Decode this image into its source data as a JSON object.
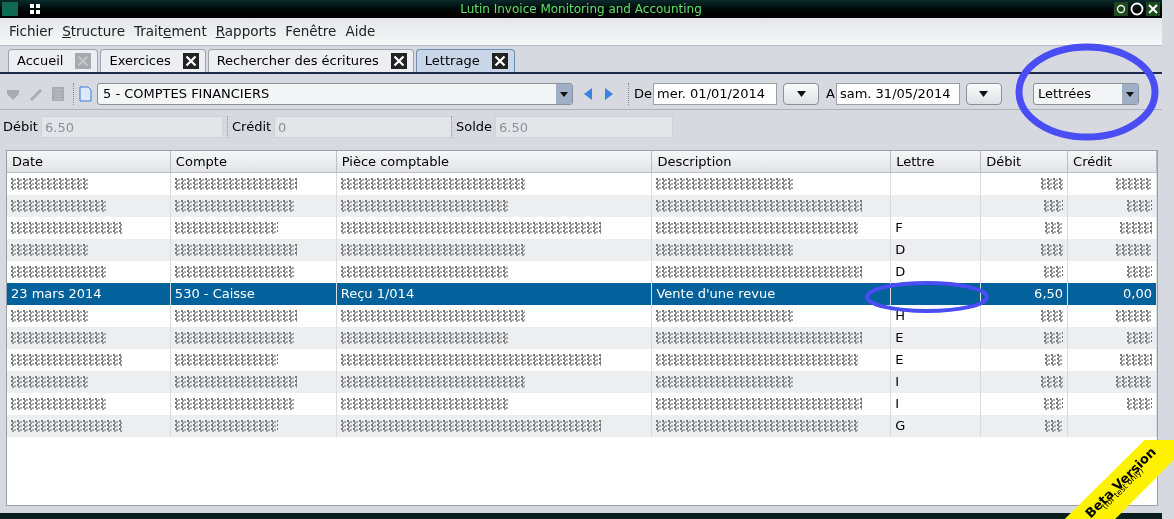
{
  "window": {
    "title": "Lutin Invoice Monitoring and Accounting"
  },
  "menu": [
    {
      "label": "Fichier"
    },
    {
      "key": "S",
      "after": "tructure"
    },
    {
      "before": "Trait",
      "key": "e",
      "after": "ment"
    },
    {
      "key": "R",
      "after": "apports"
    },
    {
      "label": "Fenêtre"
    },
    {
      "label": "Aide"
    }
  ],
  "tabs": [
    {
      "label": "Accueil",
      "selected": false,
      "close_enabled": false
    },
    {
      "label": "Exercices",
      "selected": false,
      "close_enabled": true
    },
    {
      "label": "Rechercher des écritures",
      "selected": false,
      "close_enabled": true
    },
    {
      "label": "Lettrage",
      "selected": true,
      "close_enabled": true
    }
  ],
  "toolbar": {
    "account": "5 - COMPTES FINANCIERS",
    "from_label": "De",
    "from": "mer. 01/01/2014",
    "to_label": "A",
    "to": "sam. 31/05/2014",
    "filter": "Lettrées"
  },
  "totals": [
    {
      "label": "Débit",
      "value": "6.50"
    },
    {
      "label": "Crédit",
      "value": "0"
    },
    {
      "label": "Solde",
      "value": "6.50"
    }
  ],
  "table": {
    "columns": [
      "Date",
      "Compte",
      "Pièce comptable",
      "Description",
      "Lettre",
      "Débit",
      "Crédit"
    ],
    "rows": [
      {
        "kind": "blurred",
        "selected": false,
        "lettre": ""
      },
      {
        "kind": "blurred",
        "selected": false,
        "lettre": ""
      },
      {
        "kind": "blurred",
        "selected": false,
        "lettre": "F"
      },
      {
        "kind": "blurred",
        "selected": false,
        "lettre": "D"
      },
      {
        "kind": "blurred",
        "selected": false,
        "lettre": "D"
      },
      {
        "kind": "plain",
        "selected": true,
        "cells": [
          "23 mars 2014",
          "530 - Caisse",
          "Reçu 1/014",
          "Vente d'une revue",
          "",
          "6,50",
          "0,00"
        ]
      },
      {
        "kind": "blurred",
        "selected": false,
        "lettre": "H"
      },
      {
        "kind": "blurred",
        "selected": false,
        "lettre": "E"
      },
      {
        "kind": "blurred",
        "selected": false,
        "lettre": "E"
      },
      {
        "kind": "blurred",
        "selected": false,
        "lettre": "I"
      },
      {
        "kind": "blurred",
        "selected": false,
        "lettre": "I"
      },
      {
        "kind": "blurred",
        "selected": false,
        "lettre": "G"
      }
    ]
  },
  "banner": {
    "title": "Beta Version",
    "subtitle": "(for test only)"
  }
}
